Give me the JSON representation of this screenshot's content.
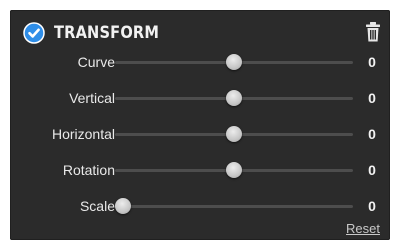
{
  "panel": {
    "title": "TRANSFORM",
    "enabled": true,
    "header_icon": "check-circle-icon",
    "delete_icon": "trash-icon",
    "accent_color": "#2f8ee8",
    "reset_label": "Reset"
  },
  "sliders": [
    {
      "label": "Curve",
      "value": "0",
      "position": 0.5
    },
    {
      "label": "Vertical",
      "value": "0",
      "position": 0.5
    },
    {
      "label": "Horizontal",
      "value": "0",
      "position": 0.5
    },
    {
      "label": "Rotation",
      "value": "0",
      "position": 0.5
    },
    {
      "label": "Scale",
      "value": "0",
      "position": 0.0
    }
  ]
}
